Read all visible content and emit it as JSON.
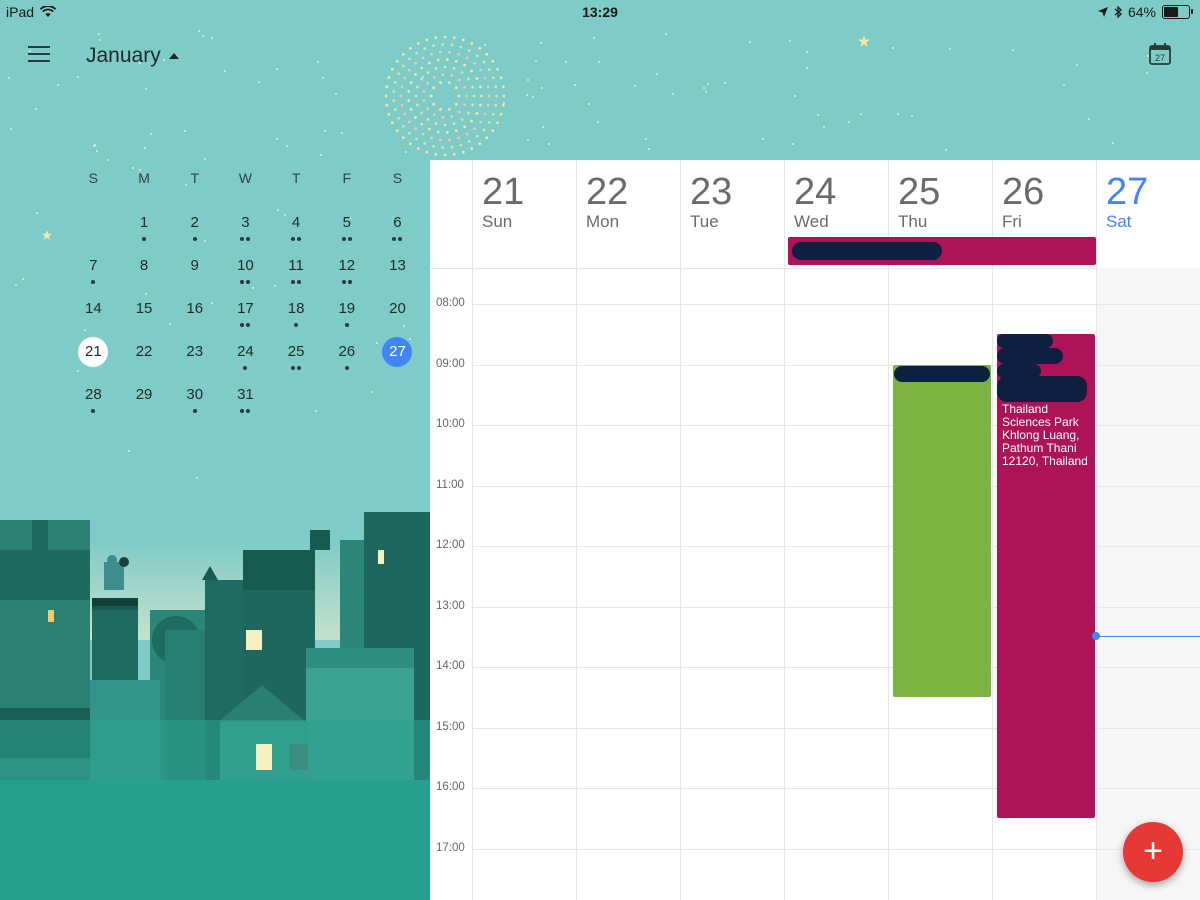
{
  "status_bar": {
    "device": "iPad",
    "time": "13:29",
    "battery": "64%",
    "battery_level": 0.64
  },
  "header": {
    "month": "January",
    "today_icon_day": "27"
  },
  "mini_calendar": {
    "weekday_headers": [
      "S",
      "M",
      "T",
      "W",
      "T",
      "F",
      "S"
    ],
    "today": "21",
    "selected": "27",
    "weeks": [
      [
        {
          "d": "",
          "n": 0
        },
        {
          "d": "1",
          "n": 1
        },
        {
          "d": "2",
          "n": 1
        },
        {
          "d": "3",
          "n": 2
        },
        {
          "d": "4",
          "n": 2
        },
        {
          "d": "5",
          "n": 2
        },
        {
          "d": "6",
          "n": 2
        }
      ],
      [
        {
          "d": "7",
          "n": 1
        },
        {
          "d": "8",
          "n": 0
        },
        {
          "d": "9",
          "n": 0
        },
        {
          "d": "10",
          "n": 2
        },
        {
          "d": "11",
          "n": 2
        },
        {
          "d": "12",
          "n": 2
        },
        {
          "d": "13",
          "n": 0
        }
      ],
      [
        {
          "d": "14",
          "n": 0
        },
        {
          "d": "15",
          "n": 0
        },
        {
          "d": "16",
          "n": 0
        },
        {
          "d": "17",
          "n": 2
        },
        {
          "d": "18",
          "n": 1
        },
        {
          "d": "19",
          "n": 1
        },
        {
          "d": "20",
          "n": 0
        }
      ],
      [
        {
          "d": "21",
          "n": 0
        },
        {
          "d": "22",
          "n": 0
        },
        {
          "d": "23",
          "n": 0
        },
        {
          "d": "24",
          "n": 1
        },
        {
          "d": "25",
          "n": 2
        },
        {
          "d": "26",
          "n": 1
        },
        {
          "d": "27",
          "n": 0
        }
      ],
      [
        {
          "d": "28",
          "n": 1
        },
        {
          "d": "29",
          "n": 0
        },
        {
          "d": "30",
          "n": 1
        },
        {
          "d": "31",
          "n": 2
        },
        {
          "d": "",
          "n": 0
        },
        {
          "d": "",
          "n": 0
        },
        {
          "d": "",
          "n": 0
        }
      ]
    ]
  },
  "week_view": {
    "days": [
      {
        "num": "21",
        "name": "Sun"
      },
      {
        "num": "22",
        "name": "Mon"
      },
      {
        "num": "23",
        "name": "Tue"
      },
      {
        "num": "24",
        "name": "Wed"
      },
      {
        "num": "25",
        "name": "Thu"
      },
      {
        "num": "26",
        "name": "Fri"
      },
      {
        "num": "27",
        "name": "Sat",
        "selected": true
      }
    ],
    "times": [
      "08:00",
      "09:00",
      "10:00",
      "11:00",
      "12:00",
      "13:00",
      "14:00",
      "15:00",
      "16:00",
      "17:00"
    ],
    "events": {
      "all_day": {
        "color": "#ad1457",
        "start_day": "Wed",
        "end_day": "Fri"
      },
      "thursday": {
        "color": "#7cb342",
        "start": "09:00",
        "end": "14:30"
      },
      "friday": {
        "color": "#ad1457",
        "start": "08:30",
        "end": "16:30",
        "location": "Thailand\nSciences Park\nKhlong Luang,\nPathum Thani\n12120, Thailand"
      }
    },
    "now_time": "13:29"
  },
  "fab": {
    "label": "+",
    "color": "#e53935"
  },
  "colors": {
    "accent": "#4285f4",
    "background": "#7fcbc7"
  }
}
